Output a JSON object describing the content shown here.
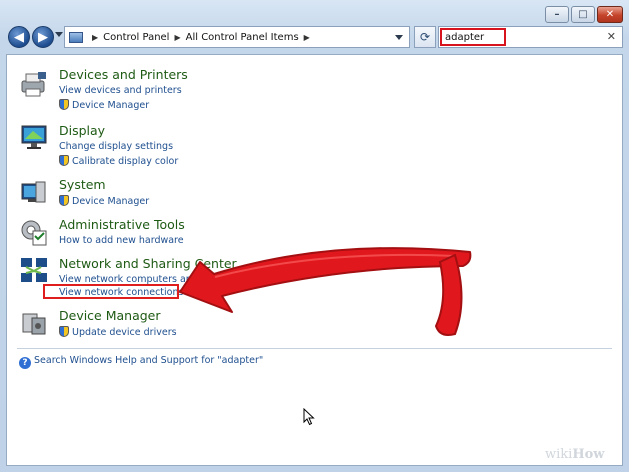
{
  "window": {
    "caption": {
      "minimize": "–",
      "maximize": "□",
      "close": "✕"
    }
  },
  "address_bar": {
    "breadcrumbs": [
      "Control Panel",
      "All Control Panel Items"
    ],
    "search_value": "adapter",
    "search_clear": "✕",
    "refresh_icon": "⟳"
  },
  "results": [
    {
      "title": "Devices and Printers",
      "links": [
        {
          "text": "View devices and printers",
          "shield": false
        },
        {
          "text": "Device Manager",
          "shield": true
        }
      ],
      "icon": "printer-icon"
    },
    {
      "title": "Display",
      "links": [
        {
          "text": "Change display settings",
          "shield": false
        },
        {
          "text": "Calibrate display color",
          "shield": true
        }
      ],
      "icon": "monitor-icon"
    },
    {
      "title": "System",
      "links": [
        {
          "text": "Device Manager",
          "shield": true
        }
      ],
      "icon": "system-icon"
    },
    {
      "title": "Administrative Tools",
      "links": [
        {
          "text": "How to add new hardware",
          "shield": false
        }
      ],
      "icon": "admin-tools-icon"
    },
    {
      "title": "Network and Sharing Center",
      "links": [
        {
          "text": "View network computers and de",
          "shield": false
        },
        {
          "text": "View network connections",
          "shield": false
        }
      ],
      "icon": "network-icon"
    },
    {
      "title": "Device Manager",
      "links": [
        {
          "text": "Update device drivers",
          "shield": true
        }
      ],
      "icon": "device-manager-icon"
    }
  ],
  "help": {
    "text": "Search Windows Help and Support for \"adapter\""
  },
  "watermark": {
    "prefix": "wiki",
    "suffix": "How"
  },
  "colors": {
    "highlight": "#e01d1d",
    "title_green": "#1e5a14",
    "link_blue": "#1f4f8f"
  }
}
